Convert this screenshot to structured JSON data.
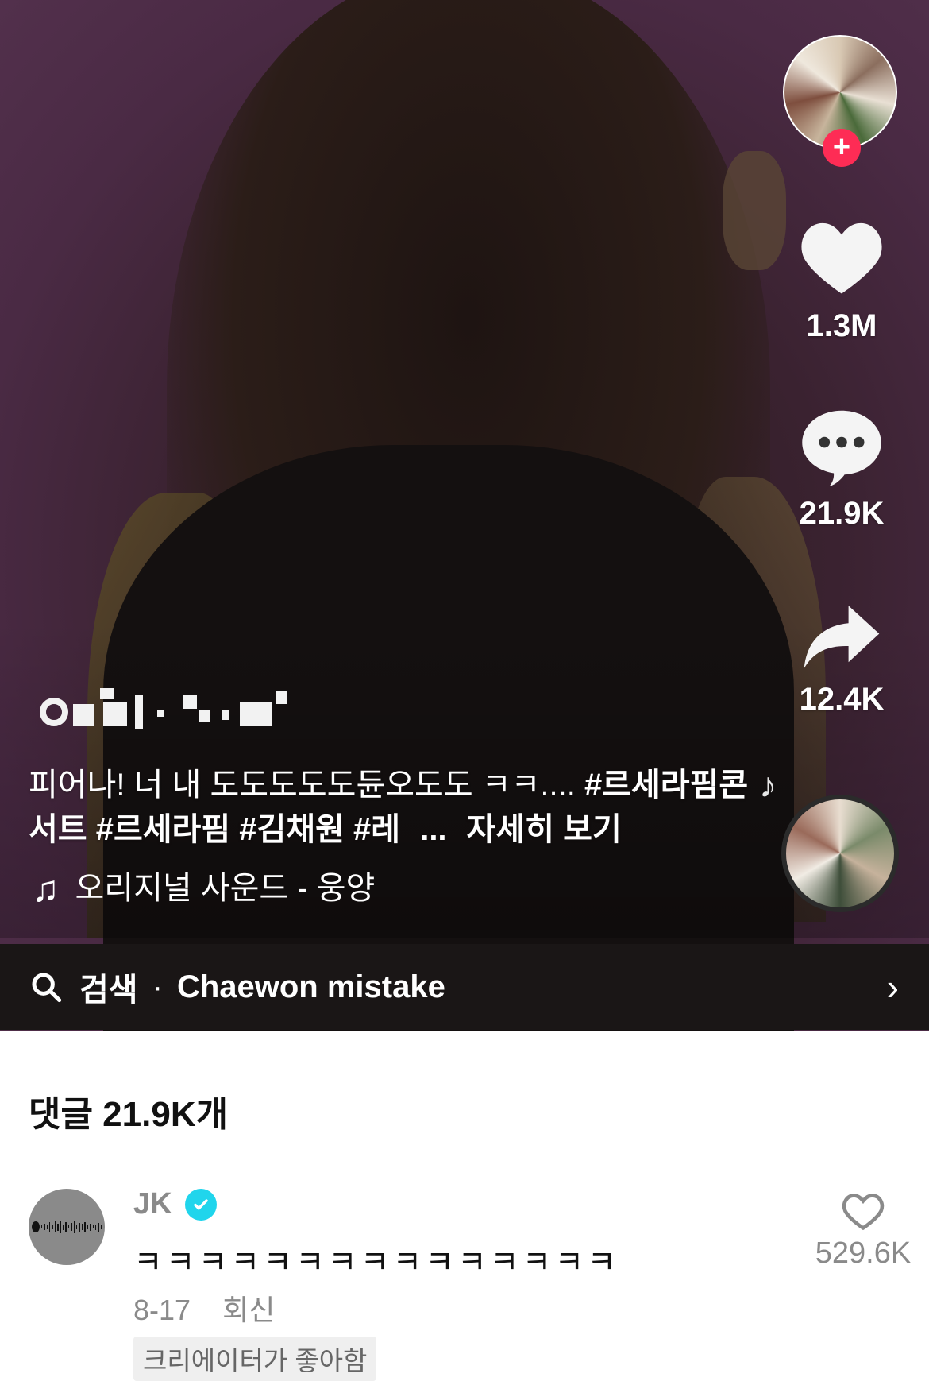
{
  "video": {
    "caption_text": "피어나! 너 내 도도도도도듄오도도 ㅋㅋ.... ",
    "hashtags": "#르세라핌콘서트 #르세라핌 #김채원 #레",
    "ellipsis": "...",
    "see_more": "자세히 보기",
    "sound": "오리지널 사운드 - 웅양"
  },
  "actions": {
    "like_count": "1.3M",
    "comment_count": "21.9K",
    "share_count": "12.4K",
    "follow_icon": "plus-icon"
  },
  "search_bar": {
    "label": "검색",
    "separator": "·",
    "query": "Chaewon mistake",
    "chevron": "›"
  },
  "comments": {
    "title": "댓글 21.9K개",
    "items": [
      {
        "author": "JK",
        "verified": true,
        "text": "ㅋㅋㅋㅋㅋㅋㅋㅋㅋㅋㅋㅋㅋㅋㅋ",
        "date": "8-17",
        "reply_label": "회신",
        "creator_liked": "크리에이터가 좋아함",
        "likes": "529.6K"
      }
    ]
  },
  "colors": {
    "accent": "#fe2c55",
    "verified": "#20d5ec",
    "muted_text": "#8a8a8a"
  }
}
